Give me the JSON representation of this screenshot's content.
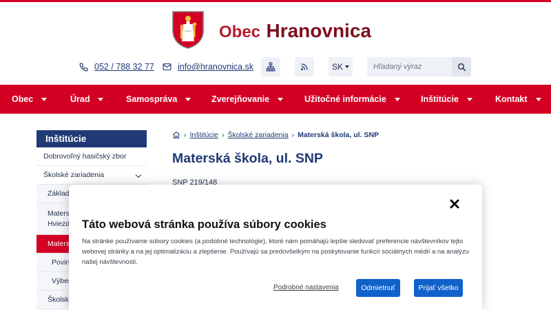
{
  "brand": {
    "prefix": "Obec",
    "name": "Hranovnica"
  },
  "contact": {
    "phone": "052 / 788 32 77",
    "email": "info@hranovnica.sk",
    "icons": [
      "phone-icon",
      "mail-icon",
      "sitemap-icon",
      "rss-icon",
      "search-icon"
    ]
  },
  "language": {
    "selected": "SK"
  },
  "search": {
    "placeholder": "Hľadaný výraz"
  },
  "nav": {
    "items": [
      {
        "label": "Obec"
      },
      {
        "label": "Úrad"
      },
      {
        "label": "Samospráva"
      },
      {
        "label": "Zverejňovanie"
      },
      {
        "label": "Užitočné informácie"
      },
      {
        "label": "Inštitúcie"
      },
      {
        "label": "Kontakt"
      }
    ]
  },
  "sidebar": {
    "title": "Inštitúcie",
    "items": [
      {
        "label": "Dobrovoľný hasičský zbor"
      },
      {
        "label": "Školské zariadenia"
      },
      {
        "label": "Základná škola"
      },
      {
        "label": "Materská škola Hviezdoslavova"
      },
      {
        "label": "Materská škola, ul. SNP"
      },
      {
        "label": "Povinné zverejňovanie"
      },
      {
        "label": "Výberové konania"
      },
      {
        "label": "Školská jedáleň"
      }
    ]
  },
  "breadcrumb": {
    "items": [
      {
        "label": "Inštitúcie"
      },
      {
        "label": "Školské zariadenia"
      },
      {
        "label": "Materská škola, ul. SNP"
      }
    ]
  },
  "page": {
    "title": "Materská škola, ul. SNP",
    "address": "SNP 219/148"
  },
  "cookie": {
    "title": "Táto webová stránka používa súbory cookies",
    "text": "Na stránke používame súbory cookies (a podobné technológie), ktoré nám pomáhajú lepšie sledovať preferencie návštevníkov tejto webovej stránky a na jej optimalizáciu a zlepšenie. Používajú sa predovšetkým na poskytovanie funkcií sociálnych médií a na analýzu našej návštevnosti.",
    "settings_link": "Podrobné nastavenia",
    "reject_label": "Odmietnuť",
    "accept_label": "Prijať všetko"
  },
  "colors": {
    "brand_red": "#d40024",
    "navy": "#1f3a74",
    "button_blue": "#1061c9",
    "title_red": "#7d0f1e"
  }
}
